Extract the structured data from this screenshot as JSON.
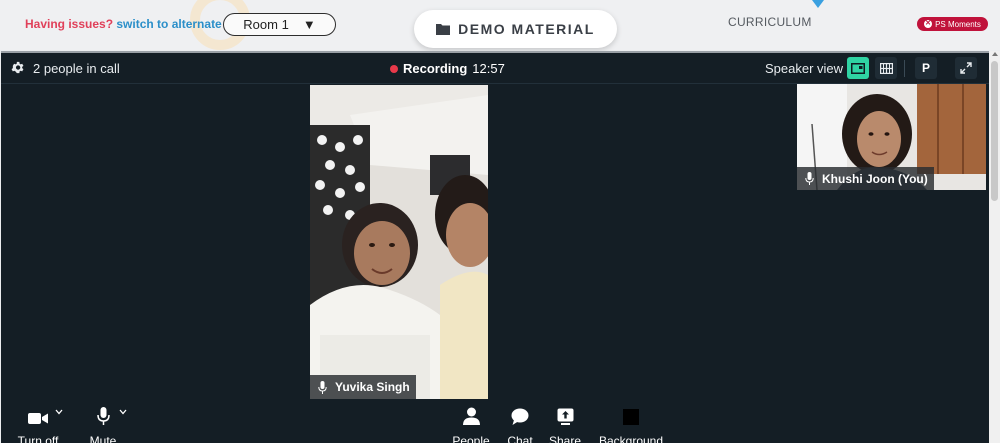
{
  "topbar": {
    "issue_text": "Having issues?",
    "alternate_link": "switch to alternate room",
    "room_selected": "Room 1",
    "demo_material_label": "DEMO MATERIAL",
    "curriculum_label": "CURRICULUM",
    "ps_moments_label": "PS Moments"
  },
  "call": {
    "people_count": "2 people in call",
    "recording_label": "Recording",
    "recording_time": "12:57",
    "view_label": "Speaker view",
    "participant_btn": "P",
    "main_participant": "Yuvika Singh",
    "self_participant": "Khushi Joon (You)"
  },
  "toolbar": {
    "camera_label": "Turn off",
    "mic_label": "Mute",
    "people_label": "People",
    "chat_label": "Chat",
    "share_label": "Share",
    "background_label": "Background"
  },
  "colors": {
    "call_bg": "#141e25",
    "accent": "#2fd3a3",
    "recording": "#e8394a",
    "ps_moments": "#c0123b",
    "warning": "#e0405a",
    "link": "#2b8fc9"
  }
}
